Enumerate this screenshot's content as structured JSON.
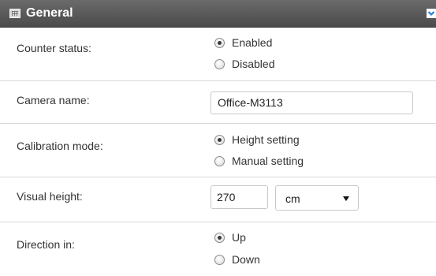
{
  "panel": {
    "title": "General",
    "icons": {
      "header": "settings-grid-icon",
      "collapse": "chevron-down-icon"
    }
  },
  "fields": {
    "counter_status": {
      "label": "Counter status:",
      "options": [
        "Enabled",
        "Disabled"
      ],
      "selected": "Enabled"
    },
    "camera_name": {
      "label": "Camera name:",
      "value": "Office-M3113"
    },
    "calibration_mode": {
      "label": "Calibration mode:",
      "options": [
        "Height setting",
        "Manual setting"
      ],
      "selected": "Height setting"
    },
    "visual_height": {
      "label": "Visual height:",
      "value": "270",
      "unit": "cm"
    },
    "direction_in": {
      "label": "Direction in:",
      "options": [
        "Up",
        "Down"
      ],
      "selected": "Up"
    }
  },
  "colors": {
    "header_bg": "#555555",
    "header_text": "#ffffff",
    "collapse_icon": "#2a7fd4",
    "row_divider": "#d9d9d9"
  }
}
